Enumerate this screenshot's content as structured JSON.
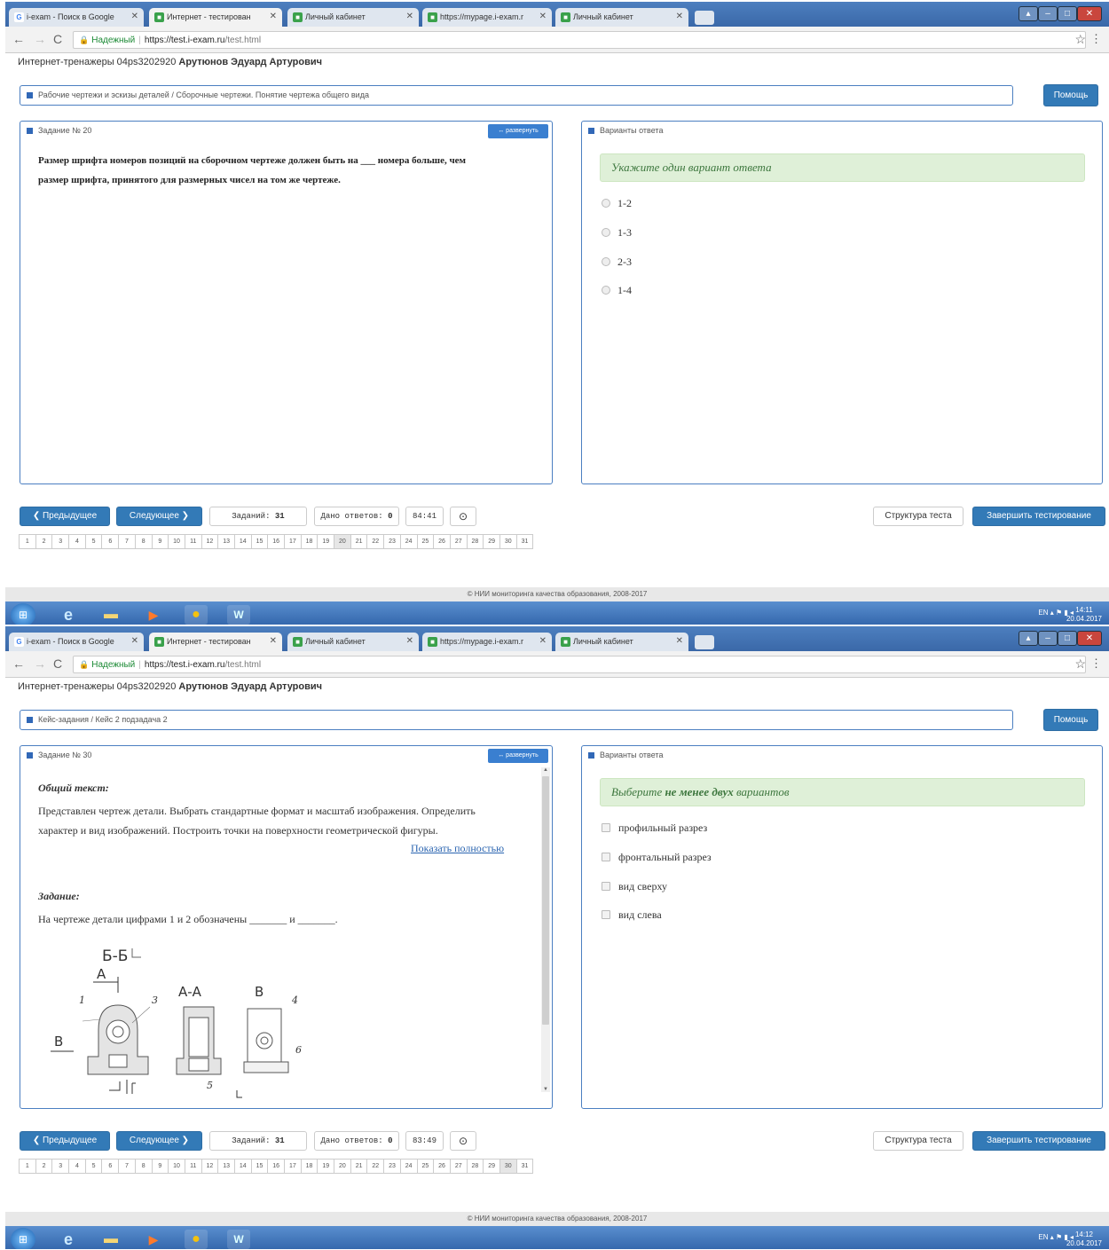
{
  "browser": {
    "tabs": [
      {
        "title": "i-exam - Поиск в Google"
      },
      {
        "title": "Интернет - тестирован"
      },
      {
        "title": "Личный кабинет"
      },
      {
        "title": "https://mypage.i-exam.r"
      },
      {
        "title": "Личный кабинет"
      }
    ],
    "secure_label": "Надежный",
    "url_host": "https://test.i-exam.ru",
    "url_path": "/test.html"
  },
  "user": {
    "prefix": "Интернет-тренажеры 04ps3202920",
    "name": "Арутюнов Эдуард Артурович"
  },
  "help_label": "Помощь",
  "answers_header": "Варианты ответа",
  "expand_label": "↔ развернуть",
  "nav": {
    "prev_label": "❮ Предыдущее",
    "next_label": "Следующее ❯",
    "tasks_label": "Заданий:",
    "tasks_count": "31",
    "answered_label": "Дано ответов:",
    "answered_count": "0",
    "timer_icon": "⊙",
    "structure_label": "Структура теста",
    "finish_label": "Завершить тестирование",
    "pages": [
      "1",
      "2",
      "3",
      "4",
      "5",
      "6",
      "7",
      "8",
      "9",
      "10",
      "11",
      "12",
      "13",
      "14",
      "15",
      "16",
      "17",
      "18",
      "19",
      "20",
      "21",
      "22",
      "23",
      "24",
      "25",
      "26",
      "27",
      "28",
      "29",
      "30",
      "31"
    ]
  },
  "footer": "© НИИ мониторинга качества образования, 2008-2017",
  "tray": {
    "lang": "EN"
  },
  "screens": [
    {
      "breadcrumb": "Рабочие чертежи и эскизы деталей / Сборочные чертежи. Понятие чертежа общего вида",
      "task_header": "Задание № 20",
      "question": "Размер шрифта номеров позиций на сборочном чертеже должен быть на ___ номера больше, чем размер шрифта, принятого для размерных чисел на том же чертеже.",
      "hint": "Укажите один вариант ответа",
      "options": [
        "1-2",
        "1-3",
        "2-3",
        "1-4"
      ],
      "timer": "84:41",
      "clock_time": "14:11",
      "clock_date": "20.04.2017"
    },
    {
      "breadcrumb": "Кейс-задания / Кейс 2 подзадача 2",
      "task_header": "Задание № 30",
      "general_title": "Общий текст:",
      "general_text": "Представлен чертеж детали. Выбрать стандартные формат и масштаб изображения. Определить характер и вид изображений. Построить точки на поверхности геометрической фигуры.",
      "show_full": "Показать полностью",
      "task_title": "Задание:",
      "task_text": "На чертеже детали цифрами 1 и 2 обозначены _______ и _______.",
      "hint_pre": "Выберите ",
      "hint_bold": "не менее двух",
      "hint_post": " вариантов",
      "options": [
        "профильный разрез",
        "фронтальный разрез",
        "вид сверху",
        "вид слева"
      ],
      "timer": "83:49",
      "clock_time": "14:12",
      "clock_date": "20.04.2017",
      "drawing_labels": {
        "section_bb": "Б-Б",
        "section_aa": "А-А",
        "arrow_a": "А",
        "arrow_b": "Б",
        "view_b_left": "В",
        "view_b": "В",
        "n1": "1",
        "n3": "3",
        "n4": "4",
        "n5": "5",
        "n6": "6"
      }
    }
  ]
}
